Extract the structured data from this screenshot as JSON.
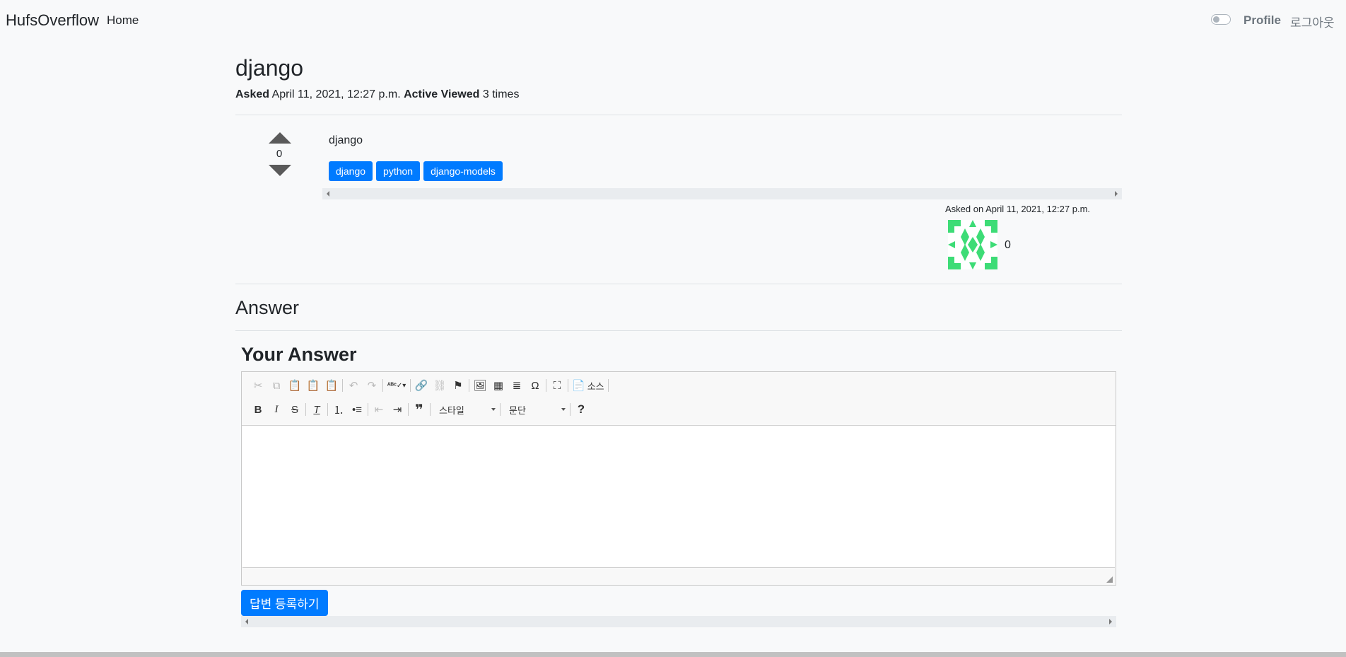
{
  "navbar": {
    "brand": "HufsOverflow",
    "home": "Home",
    "profile": "Profile",
    "logout": "로그아웃"
  },
  "question": {
    "title": "django",
    "asked_label": "Asked",
    "asked_date": "April 11, 2021, 12:27 p.m.",
    "active_label": "Active",
    "viewed_label": "Viewed",
    "viewed_value": "3 times",
    "votes": "0",
    "body": "django",
    "tags": [
      "django",
      "python",
      "django-models"
    ],
    "asked_on": "Asked on April 11, 2021, 12:27 p.m.",
    "reputation": "0"
  },
  "answers": {
    "heading": "Answer"
  },
  "editor": {
    "heading": "Your Answer",
    "source_label": "소스",
    "style_combo": "스타일",
    "format_combo": "문단"
  },
  "submit_label": "답변 등록하기",
  "colors": {
    "primary": "#007bff",
    "avatar": "#3ddc76"
  }
}
